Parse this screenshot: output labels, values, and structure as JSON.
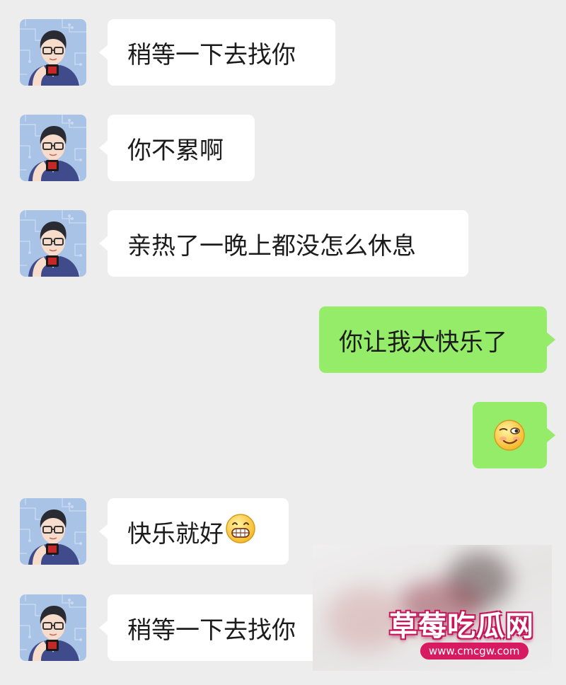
{
  "messages": [
    {
      "side": "in",
      "text": "稍等一下去找你"
    },
    {
      "side": "in",
      "text": "你不累啊"
    },
    {
      "side": "in",
      "text": "亲热了一晚上都没怎么休息"
    },
    {
      "side": "out",
      "text": "你让我太快乐了"
    },
    {
      "side": "out",
      "emoji": "smirk-emoji"
    },
    {
      "side": "in",
      "text": "快乐就好",
      "emoji": "grin-emoji"
    },
    {
      "side": "in",
      "text": "稍等一下去找你"
    }
  ],
  "watermark": {
    "title": "草莓吃瓜网",
    "url": "www.cmcgw.com"
  },
  "colors": {
    "background": "#ededed",
    "incoming_bubble": "#ffffff",
    "outgoing_bubble": "#95ec69",
    "watermark_accent": "#d81b60"
  }
}
